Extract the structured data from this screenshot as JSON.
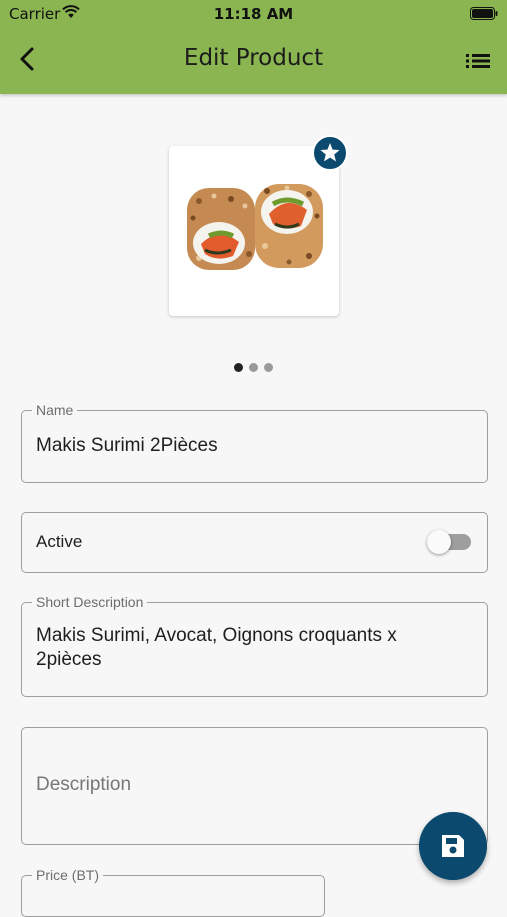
{
  "status_bar": {
    "carrier": "Carrier",
    "time": "11:18 AM",
    "icons": [
      "wifi-icon",
      "battery-icon"
    ]
  },
  "app_bar": {
    "title": "Edit Product",
    "back_icon": "chevron-left-icon",
    "menu_icon": "list-icon"
  },
  "product_image": {
    "badge_icon": "star-icon",
    "image": "sushi-rolls",
    "pager": {
      "count": 3,
      "active_index": 0
    }
  },
  "form": {
    "name": {
      "label": "Name",
      "value": "Makis Surimi 2Pièces"
    },
    "active": {
      "label": "Active",
      "value": false
    },
    "short_description": {
      "label": "Short Description",
      "value": "Makis Surimi, Avocat, Oignons croquants x 2pièces"
    },
    "description": {
      "placeholder": "Description",
      "value": ""
    },
    "price": {
      "label": "Price (BT)"
    }
  },
  "fab": {
    "icon": "save-icon"
  },
  "colors": {
    "app_bar": "#8ab551",
    "accent": "#0b4a6e",
    "background": "#f7f7f7"
  }
}
